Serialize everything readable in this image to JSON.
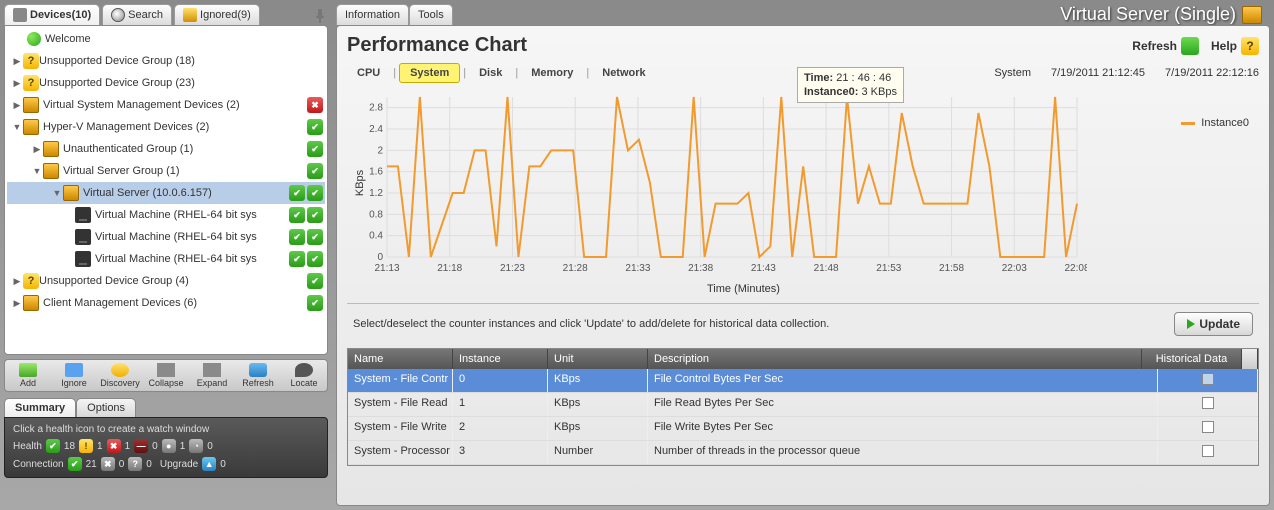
{
  "left_tabs": {
    "devices": "Devices(10)",
    "search": "Search",
    "ignored": "Ignored(9)"
  },
  "tree": {
    "welcome": "Welcome",
    "unsupported18": "Unsupported Device Group (18)",
    "unsupported23": "Unsupported Device Group (23)",
    "vsmd": "Virtual System Management Devices (2)",
    "hyperv": "Hyper-V Management Devices (2)",
    "unauth": "Unauthenticated Group (1)",
    "vsg": "Virtual Server Group (1)",
    "vs": "Virtual Server (10.0.6.157)",
    "vm1": "Virtual Machine (RHEL-64 bit sys",
    "vm2": "Virtual Machine (RHEL-64 bit sys",
    "vm3": "Virtual Machine (RHEL-64 bit sys",
    "unsupported4": "Unsupported Device Group (4)",
    "cmd": "Client Management Devices (6)"
  },
  "toolbar": {
    "add": "Add",
    "ignore": "Ignore",
    "discovery": "Discovery",
    "collapse": "Collapse",
    "expand": "Expand",
    "refresh": "Refresh",
    "locate": "Locate"
  },
  "summary_tabs": {
    "summary": "Summary",
    "options": "Options"
  },
  "summary": {
    "hint": "Click a health icon to create a watch window",
    "health_label": "Health",
    "health_green": "18",
    "health_yellow": "1",
    "health_red": "1",
    "health_stop": "0",
    "health_gray": "1",
    "health_clock": "0",
    "conn_label": "Connection",
    "conn_green": "21",
    "conn_disc": "0",
    "conn_unk": "0",
    "upgrade_label": "Upgrade",
    "upgrade_val": "0"
  },
  "right_tabs": {
    "info": "Information",
    "tools": "Tools"
  },
  "title": "Virtual Server (Single)",
  "header": {
    "title": "Performance Chart",
    "refresh": "Refresh",
    "help": "Help"
  },
  "chart_tabs": {
    "cpu": "CPU",
    "system": "System",
    "disk": "Disk",
    "memory": "Memory",
    "network": "Network"
  },
  "time_row": {
    "label": "System",
    "from": "7/19/2011 21:12:45",
    "to": "7/19/2011 22:12:16"
  },
  "tooltip": {
    "time_label": "Time:",
    "time": "21 : 46 : 46",
    "inst_label": "Instance0:",
    "inst": "3 KBps"
  },
  "legend": "Instance0",
  "axes": {
    "x": "Time (Minutes)",
    "y": "KBps"
  },
  "chart_data": {
    "type": "line",
    "xlabel": "Time (Minutes)",
    "ylabel": "KBps",
    "ylim": [
      0,
      3.0
    ],
    "x_ticks": [
      "21:13",
      "21:18",
      "21:23",
      "21:28",
      "21:33",
      "21:38",
      "21:43",
      "21:48",
      "21:53",
      "21:58",
      "22:03",
      "22:08"
    ],
    "y_ticks": [
      0,
      0.4,
      0.8,
      1.2,
      1.6,
      2,
      2.4,
      2.8
    ],
    "series": [
      {
        "name": "Instance0",
        "color": "#f29a2e",
        "values": [
          1.7,
          1.7,
          0,
          3.0,
          0,
          0.6,
          1.2,
          1.2,
          2.0,
          2.0,
          0.2,
          3.0,
          0,
          1.7,
          1.7,
          2.0,
          2.0,
          2.0,
          0,
          0,
          0,
          3.0,
          2.0,
          2.2,
          1.4,
          0,
          0,
          0,
          3.0,
          0,
          1.0,
          1.0,
          1.0,
          1.2,
          0,
          0.2,
          3.0,
          0,
          1.7,
          0,
          0,
          0,
          3.0,
          1.0,
          1.7,
          1.0,
          1.0,
          2.7,
          1.7,
          1.0,
          1.0,
          1.0,
          1.0,
          1.0,
          2.7,
          1.7,
          0,
          0,
          0,
          0,
          0,
          3.0,
          0,
          1.0
        ]
      }
    ]
  },
  "counter_hint": "Select/deselect the counter instances and click 'Update' to add/delete for historical data collection.",
  "update": "Update",
  "table": {
    "head": {
      "name": "Name",
      "instance": "Instance",
      "unit": "Unit",
      "description": "Description",
      "hist": "Historical Data"
    },
    "rows": [
      {
        "name": "System - File Contr",
        "instance": "0",
        "unit": "KBps",
        "desc": "File Control Bytes Per Sec",
        "checked": true
      },
      {
        "name": "System - File Read",
        "instance": "1",
        "unit": "KBps",
        "desc": "File Read Bytes Per Sec",
        "checked": false
      },
      {
        "name": "System - File Write",
        "instance": "2",
        "unit": "KBps",
        "desc": "File Write Bytes Per Sec",
        "checked": false
      },
      {
        "name": "System - Processor",
        "instance": "3",
        "unit": "Number",
        "desc": "Number of threads in the processor queue",
        "checked": false
      }
    ]
  }
}
